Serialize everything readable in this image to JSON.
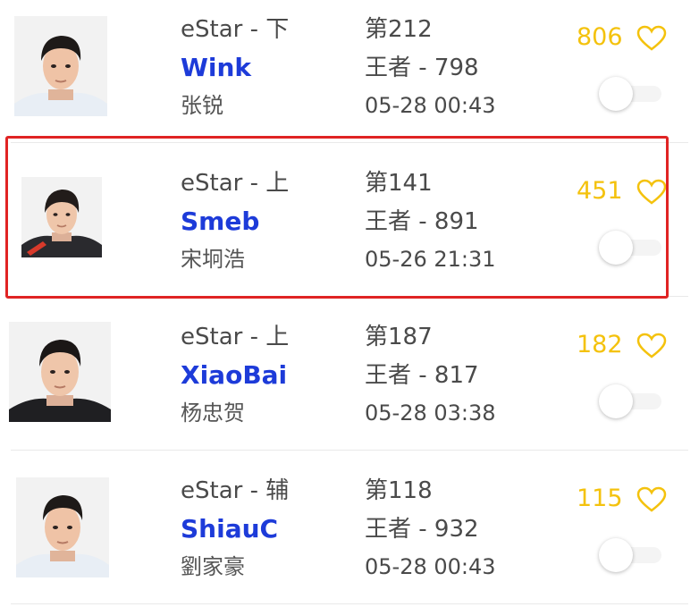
{
  "players": [
    {
      "team_role": "eStar - 下",
      "nickname": "Wink",
      "real_name": "张锐",
      "rank": "第212",
      "tier": "王者 - 798",
      "time": "05-28 00:43",
      "likes": "806"
    },
    {
      "team_role": "eStar - 上",
      "nickname": "Smeb",
      "real_name": "宋坰浩",
      "rank": "第141",
      "tier": "王者 - 891",
      "time": "05-26 21:31",
      "likes": "451"
    },
    {
      "team_role": "eStar - 上",
      "nickname": "XiaoBai",
      "real_name": "杨忠贺",
      "rank": "第187",
      "tier": "王者 - 817",
      "time": "05-28 03:38",
      "likes": "182"
    },
    {
      "team_role": "eStar - 辅",
      "nickname": "ShiauC",
      "real_name": "劉家豪",
      "rank": "第118",
      "tier": "王者 - 932",
      "time": "05-28 00:43",
      "likes": "115"
    }
  ],
  "colors": {
    "nickname": "#1d3bd9",
    "likes": "#f4c20d",
    "highlight": "#e02424",
    "text": "#4a4a4a"
  },
  "icons": {
    "like": "heart-outline-icon",
    "toggle": "switch-off"
  },
  "highlighted_row_index": 1
}
